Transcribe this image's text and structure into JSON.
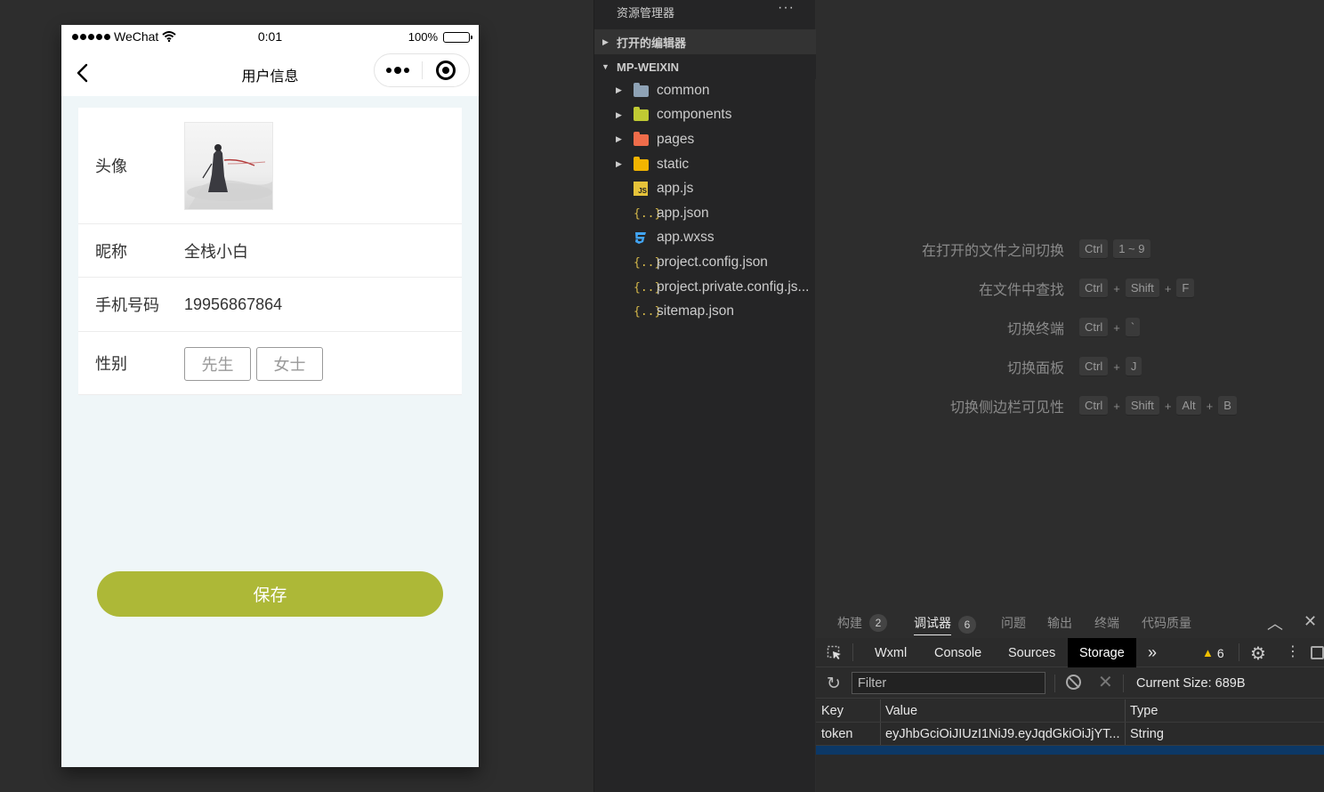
{
  "simulator": {
    "status": {
      "carrier": "WeChat",
      "time": "0:01",
      "battery": "100%"
    },
    "nav": {
      "title": "用户信息"
    },
    "form": {
      "avatar_label": "头像",
      "nickname_label": "昵称",
      "nickname_value": "全栈小白",
      "phone_label": "手机号码",
      "phone_value": "19956867864",
      "gender_label": "性别",
      "gender_options": [
        "先生",
        "女士"
      ]
    },
    "save_button": "保存",
    "colors": {
      "accent": "#adb837",
      "page_bg": "#eff6f8"
    }
  },
  "explorer": {
    "title": "资源管理器",
    "more": "···",
    "open_editors": "打开的编辑器",
    "project": "MP-WEIXIN",
    "items": [
      {
        "name": "common",
        "icon": "folder-icon"
      },
      {
        "name": "components",
        "icon": "components-folder-icon"
      },
      {
        "name": "pages",
        "icon": "pages-folder-icon"
      },
      {
        "name": "static",
        "icon": "static-folder-icon"
      },
      {
        "name": "app.js",
        "icon": "js-file-icon"
      },
      {
        "name": "app.json",
        "icon": "json-file-icon"
      },
      {
        "name": "app.wxss",
        "icon": "css-file-icon"
      },
      {
        "name": "project.config.json",
        "icon": "json-file-icon"
      },
      {
        "name": "project.private.config.js...",
        "icon": "json-file-icon"
      },
      {
        "name": "sitemap.json",
        "icon": "json-file-icon"
      }
    ]
  },
  "editor": {
    "shortcuts": [
      {
        "action": "在打开的文件之间切换",
        "keys": [
          "Ctrl",
          "1 ~ 9"
        ]
      },
      {
        "action": "在文件中查找",
        "keys": [
          "Ctrl",
          "Shift",
          "F"
        ]
      },
      {
        "action": "切换终端",
        "keys": [
          "Ctrl",
          "`"
        ]
      },
      {
        "action": "切换面板",
        "keys": [
          "Ctrl",
          "J"
        ]
      },
      {
        "action": "切换侧边栏可见性",
        "keys": [
          "Ctrl",
          "Shift",
          "Alt",
          "B"
        ]
      }
    ],
    "plus": "+"
  },
  "panel": {
    "tabs": {
      "build": "构建",
      "build_count": "2",
      "debugger": "调试器",
      "debugger_count": "6",
      "problems": "问题",
      "output": "输出",
      "terminal": "终端",
      "quality": "代码质量"
    },
    "devtools": {
      "tabs": [
        "Wxml",
        "Console",
        "Sources",
        "Storage"
      ],
      "more": "»",
      "warnings": "6"
    },
    "storage": {
      "filter_placeholder": "Filter",
      "current_size": "Current Size: 689B",
      "headers": {
        "key": "Key",
        "value": "Value",
        "type": "Type"
      },
      "rows": [
        {
          "key": "token",
          "value": "eyJhbGciOiJIUzI1NiJ9.eyJqdGkiOiJjYT...",
          "type": "String"
        }
      ]
    }
  }
}
